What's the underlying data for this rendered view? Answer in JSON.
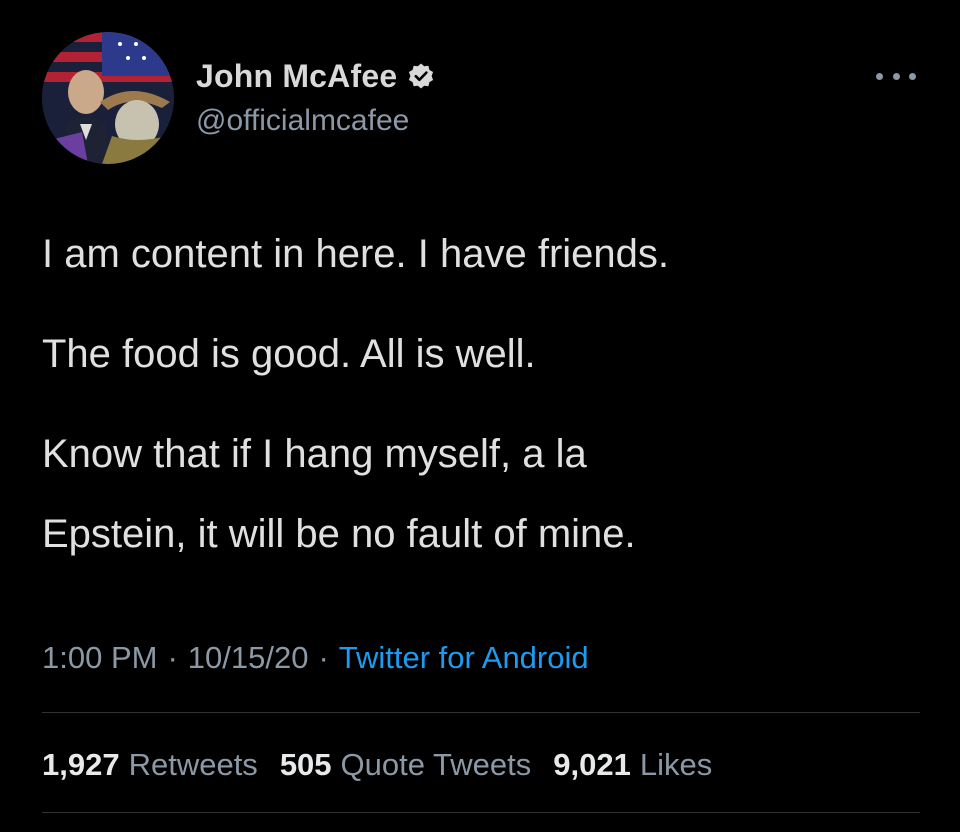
{
  "user": {
    "display_name": "John McAfee",
    "handle": "@officialmcafee",
    "verified": true,
    "verified_icon": "verified-badge-icon",
    "avatar_icon": "avatar-image"
  },
  "tweet": {
    "paragraphs": [
      "I am content in here. I have friends.",
      "The food is good. All is well.",
      "Know that if I hang myself, a la",
      "Epstein, it will be no fault of mine."
    ],
    "time": "1:00 PM",
    "date": "10/15/20",
    "source": "Twitter for Android",
    "separator": "·"
  },
  "stats": {
    "retweets_count": "1,927",
    "retweets_label": "Retweets",
    "quotes_count": "505",
    "quotes_label": "Quote Tweets",
    "likes_count": "9,021",
    "likes_label": "Likes"
  },
  "colors": {
    "background": "#000000",
    "text_primary": "#e0e0e0",
    "text_secondary": "#8b98a5",
    "link_accent": "#1d9bf0",
    "divider": "#2f3336"
  }
}
